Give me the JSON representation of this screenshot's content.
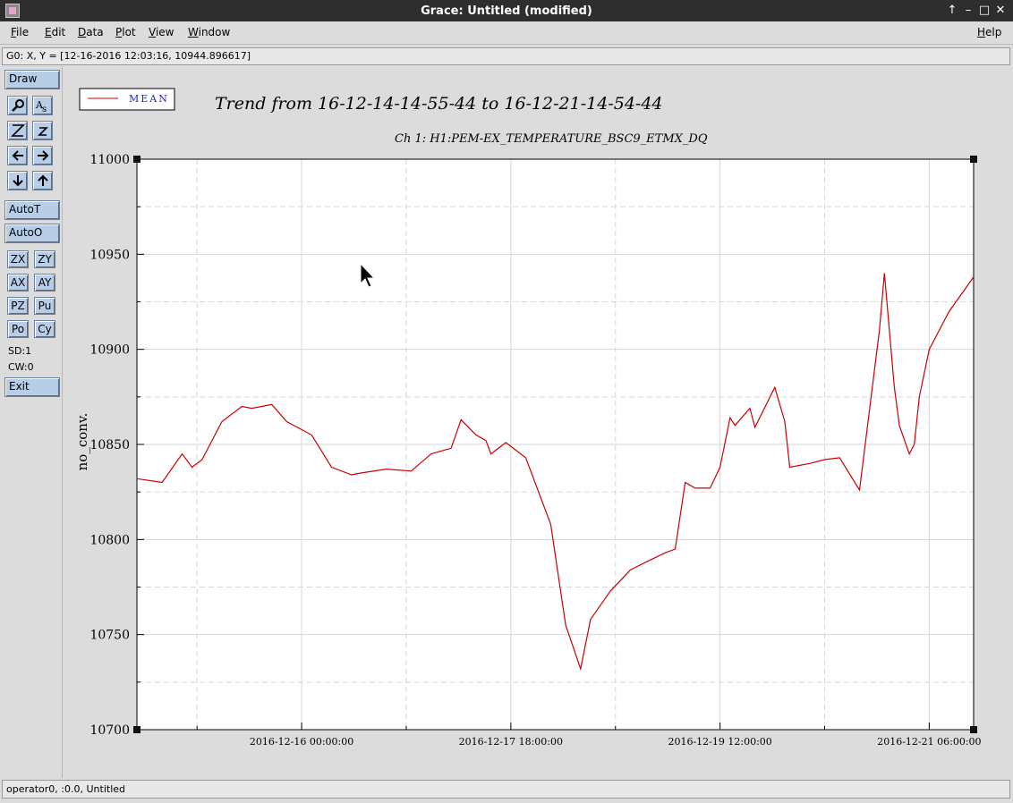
{
  "window": {
    "title": "Grace: Untitled (modified)",
    "controls": [
      "↑",
      "–",
      "□",
      "✕"
    ]
  },
  "menubar": {
    "items": [
      "File",
      "Edit",
      "Data",
      "Plot",
      "View",
      "Window"
    ],
    "help": "Help"
  },
  "locator": "G0: X, Y = [12-16-2016 12:03:16, 10944.896617]",
  "toolbar": {
    "draw": "Draw",
    "autoT": "AutoT",
    "autoO": "AutoO",
    "zx": "ZX",
    "zy": "ZY",
    "ax": "AX",
    "ay": "AY",
    "pz": "PZ",
    "pu": "Pu",
    "po": "Po",
    "cy": "Cy",
    "sd": "SD:1",
    "cw": "CW:0",
    "exit": "Exit"
  },
  "status": "operator0, :0.0, Untitled",
  "chart_data": {
    "type": "line",
    "title": "Trend from 16-12-14-14-55-44 to 16-12-21-14-54-44",
    "subtitle": "Ch 1: H1:PEM-EX_TEMPERATURE_BSC9_ETMX_DQ",
    "ylabel": "no_conv.",
    "xlabel": "",
    "xlim": [
      "2016-12-14 14:55:44",
      "2016-12-21 14:54:44"
    ],
    "ylim": [
      10700,
      11000
    ],
    "yticks": [
      10700,
      10750,
      10800,
      10850,
      10900,
      10950,
      11000
    ],
    "xticks": [
      "2016-12-16 00:00:00",
      "2016-12-17 18:00:00",
      "2016-12-19 12:00:00",
      "2016-12-21 06:00:00"
    ],
    "grid": true,
    "legend_position": "top-left",
    "color": "#cc0000",
    "series": [
      {
        "name": "MEAN",
        "x": [
          "2016-12-14 14:55",
          "2016-12-14 20:00",
          "2016-12-15 00:00",
          "2016-12-15 02:00",
          "2016-12-15 04:00",
          "2016-12-15 08:00",
          "2016-12-15 12:00",
          "2016-12-15 14:00",
          "2016-12-15 16:00",
          "2016-12-15 18:00",
          "2016-12-15 21:00",
          "2016-12-16 02:00",
          "2016-12-16 06:00",
          "2016-12-16 10:00",
          "2016-12-16 12:00",
          "2016-12-16 17:00",
          "2016-12-16 22:00",
          "2016-12-17 02:00",
          "2016-12-17 06:00",
          "2016-12-17 08:00",
          "2016-12-17 11:00",
          "2016-12-17 13:00",
          "2016-12-17 14:00",
          "2016-12-17 17:00",
          "2016-12-17 21:00",
          "2016-12-18 02:00",
          "2016-12-18 05:00",
          "2016-12-18 08:00",
          "2016-12-18 10:00",
          "2016-12-18 14:00",
          "2016-12-18 18:00",
          "2016-12-18 21:00",
          "2016-12-19 01:00",
          "2016-12-19 03:00",
          "2016-12-19 05:00",
          "2016-12-19 07:00",
          "2016-12-19 10:00",
          "2016-12-19 12:00",
          "2016-12-19 14:00",
          "2016-12-19 15:00",
          "2016-12-19 18:00",
          "2016-12-19 19:00",
          "2016-12-19 23:00",
          "2016-12-20 01:00",
          "2016-12-20 02:00",
          "2016-12-20 06:00",
          "2016-12-20 09:00",
          "2016-12-20 12:00",
          "2016-12-20 16:00",
          "2016-12-20 20:00",
          "2016-12-20 21:00",
          "2016-12-20 23:00",
          "2016-12-21 00:00",
          "2016-12-21 02:00",
          "2016-12-21 03:00",
          "2016-12-21 04:00",
          "2016-12-21 06:00",
          "2016-12-21 10:00",
          "2016-12-21 14:54"
        ],
        "y": [
          10832,
          10830,
          10845,
          10838,
          10842,
          10862,
          10870,
          10869,
          10870,
          10871,
          10862,
          10855,
          10838,
          10834,
          10835,
          10837,
          10836,
          10845,
          10848,
          10863,
          10855,
          10852,
          10845,
          10851,
          10843,
          10808,
          10755,
          10732,
          10758,
          10773,
          10784,
          10788,
          10793,
          10795,
          10830,
          10827,
          10827,
          10838,
          10864,
          10860,
          10869,
          10859,
          10880,
          10862,
          10838,
          10840,
          10842,
          10843,
          10826,
          10910,
          10940,
          10880,
          10860,
          10845,
          10850,
          10875,
          10900,
          10920,
          10938
        ]
      }
    ]
  }
}
